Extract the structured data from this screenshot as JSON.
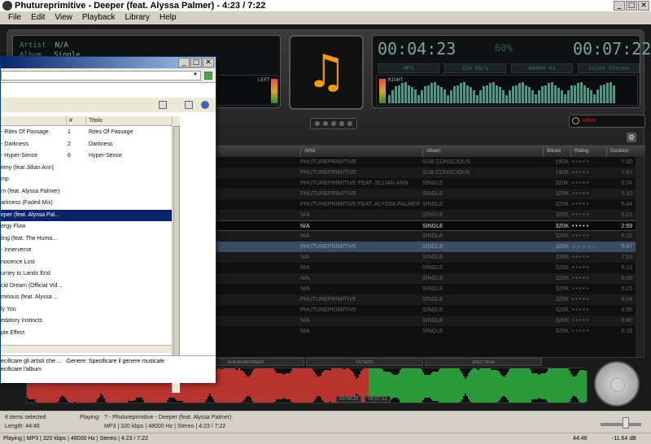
{
  "window": {
    "title": "Phutureprimitive - Deeper (feat. Alyssa Palmer) - 4:23 / 7:22",
    "minimize": "_",
    "maximize": "□",
    "close": "✕"
  },
  "menu": [
    "File",
    "Edit",
    "View",
    "Playback",
    "Library",
    "Help"
  ],
  "nowplaying": {
    "artist_key": "Artist",
    "artist_val": "N/A",
    "album_key": "Album",
    "album_val": "Single",
    "left_label": "LEFT",
    "right_label": "RIGHT",
    "elapsed": "00:04:23",
    "percent": "60%",
    "total": "00:07:22",
    "format": "MP3",
    "bitrate": "320 Kb/s",
    "samplerate": "48000 Hz",
    "channels": "Joint Stereo"
  },
  "search": {
    "text": "adoa"
  },
  "list": {
    "headers": [
      "Artist",
      "Album",
      "Bitrate",
      "Rating",
      "Duration"
    ],
    "rows": [
      {
        "artist": "PHUTUREPRIMITIVE",
        "album": "SUB CONSCIOUS",
        "bitrate": "192K",
        "rating": "• • • • •",
        "duration": "7:30"
      },
      {
        "artist": "PHUTUREPRIMITIVE",
        "album": "SUB CONSCIOUS",
        "bitrate": "192K",
        "rating": "• • • • •",
        "duration": "7:47"
      },
      {
        "artist": "PHUTUREPRIMITIVE FEAT. JILLIAN ANN",
        "album": "SINGLE",
        "bitrate": "320K",
        "rating": "• • • • •",
        "duration": "5:24"
      },
      {
        "artist": "PHUTUREPRIMITIVE",
        "album": "SINGLE",
        "bitrate": "320K",
        "rating": "• • • • •",
        "duration": "5:10"
      },
      {
        "artist": "PHUTUREPRIMITIVE FEAT. ALYSSA PALMER",
        "album": "SINGLE",
        "bitrate": "320K",
        "rating": "• • • • •",
        "duration": "5:44"
      },
      {
        "artist": "N/A",
        "album": "SINGLE",
        "bitrate": "320K",
        "rating": "• • • • •",
        "duration": "5:21"
      },
      {
        "artist": "N/A",
        "album": "SINGLE",
        "bitrate": "320K",
        "rating": "• • • • •",
        "duration": "2:59"
      },
      {
        "artist": "N/A",
        "album": "SINGLE",
        "bitrate": "320K",
        "rating": "• • • • •",
        "duration": "5:32"
      },
      {
        "artist": "PHUTUREPRIMITIVE",
        "album": "SINGLE",
        "bitrate": "320K",
        "rating": "○ ○ ○ ○ ○",
        "duration": "5:47"
      },
      {
        "artist": "N/A",
        "album": "SINGLE",
        "bitrate": "320K",
        "rating": "• • • • •",
        "duration": "7:53"
      },
      {
        "artist": "N/A",
        "album": "SINGLE",
        "bitrate": "320K",
        "rating": "• • • • •",
        "duration": "5:13"
      },
      {
        "artist": "N/A",
        "album": "SINGLE",
        "bitrate": "320K",
        "rating": "• • • • •",
        "duration": "6:09"
      },
      {
        "artist": "N/A",
        "album": "SINGLE",
        "bitrate": "320K",
        "rating": "• • • • •",
        "duration": "5:23"
      },
      {
        "artist": "PHUTUREPRIMITIVE",
        "album": "SINGLE",
        "bitrate": "320K",
        "rating": "• • • • •",
        "duration": "6:04"
      },
      {
        "artist": "PHUTUREPRIMITIVE",
        "album": "SINGLE",
        "bitrate": "320K",
        "rating": "• • • • •",
        "duration": "4:56"
      },
      {
        "artist": "N/A",
        "album": "SINGLE",
        "bitrate": "320K",
        "rating": "• • • • •",
        "duration": "5:40"
      },
      {
        "artist": "N/A",
        "album": "SINGLE",
        "bitrate": "320K",
        "rating": "• • • • •",
        "duration": "5:19"
      }
    ]
  },
  "bottom": {
    "tabs": [
      "ALBUM BROWSER",
      "FILTERS",
      "SPECTRUM"
    ],
    "wave_elapsed": "00:04:23",
    "wave_total": "00:07:22"
  },
  "status": {
    "items_selected": "8 items selected",
    "length": "Length: 44:46",
    "playing_label": "Playing:",
    "playing_track": "? - Phutureprimitive - Deeper (feat. Alyssa Palmer)",
    "playing_info": "MP3 | 320 kbps | 48000 Hz | Stereo | 4:23 / 7:22",
    "time_short": "44:46",
    "db": "-11.64 dB",
    "bottom_line": "Playing | MP3 | 320 kbps | 48000 Hz | Stereo | 4:23 / 7:22"
  },
  "dialog": {
    "headers": [
      "#",
      "Titolo"
    ],
    "rows": [
      {
        "name": "- Rites Of Passage",
        "num": "1",
        "title": "Rites Of Passage"
      },
      {
        "name": "- Darkness",
        "num": "2",
        "title": "Darkness"
      },
      {
        "name": "- Hyper-Sence",
        "num": "6",
        "title": "Hyper-Sence"
      },
      {
        "name": "emy (feat Jillian Ann)",
        "num": "",
        "title": ""
      },
      {
        "name": "mp",
        "num": "",
        "title": ""
      },
      {
        "name": "rn (feat. Alyssa Palmer)",
        "num": "",
        "title": ""
      },
      {
        "name": "arkness (Faded Mix)",
        "num": "",
        "title": ""
      },
      {
        "name": "eper (feat. Alyssa Pal...",
        "num": "",
        "title": ""
      },
      {
        "name": "ergy Flow",
        "num": "",
        "title": ""
      },
      {
        "name": "ling (feat. The Huma...",
        "num": "",
        "title": ""
      },
      {
        "name": "- Innerverse",
        "num": "",
        "title": ""
      },
      {
        "name": "nocence Lost",
        "num": "",
        "title": ""
      },
      {
        "name": "urney to Lands End",
        "num": "",
        "title": ""
      },
      {
        "name": "cid Dream (Official Vid...",
        "num": "",
        "title": ""
      },
      {
        "name": "minous (feat. Alyssa ...",
        "num": "",
        "title": ""
      },
      {
        "name": "ly You",
        "num": "",
        "title": ""
      },
      {
        "name": "edatory Instincts",
        "num": "",
        "title": ""
      },
      {
        "name": "ple Effect",
        "num": "",
        "title": ""
      }
    ],
    "foot_line1a": "ecificare gli artisti che ...",
    "foot_line1b": "Genere:  Specificare il genere musicale",
    "foot_line2": "ecificare l'album"
  }
}
